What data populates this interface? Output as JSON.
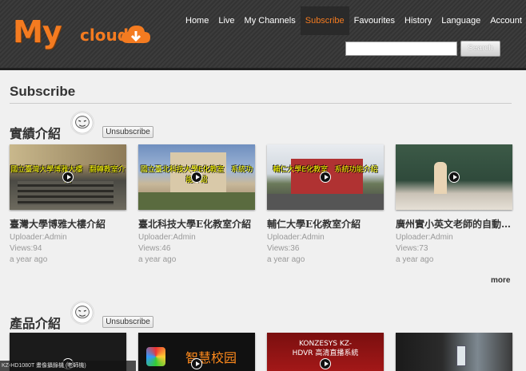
{
  "logo": {
    "my": "My",
    "cloud": "cloud"
  },
  "nav": [
    "Home",
    "Live",
    "My Channels",
    "Subscribe",
    "Favourites",
    "History",
    "Language",
    "Account"
  ],
  "search": {
    "value": "",
    "button": "Search"
  },
  "page_title": "Subscribe",
  "sections": [
    {
      "title": "實績介紹",
      "unsubscribe": "Unsubscribe",
      "videos": [
        {
          "title": "臺灣大學博雅大樓介紹",
          "uploader": "Uploader:Admin",
          "views": "Views:94",
          "date": "a year ago",
          "overlay": "國立臺灣大學博雅大樓   翻轉教室介紹"
        },
        {
          "title": "臺北科技大學E化教室介紹",
          "uploader": "Uploader:Admin",
          "views": "Views:46",
          "date": "a year ago",
          "overlay": "國立臺北科技大學E化教室   系統功能介紹"
        },
        {
          "title": "輔仁大學E化教室介紹",
          "uploader": "Uploader:Admin",
          "views": "Views:36",
          "date": "a year ago",
          "overlay": "輔仁大學E化教室   系統功能介紹"
        },
        {
          "title": "廣州實小英文老師的自動…",
          "uploader": "Uploader:Admin",
          "views": "Views:73",
          "date": "a year ago",
          "overlay": ""
        }
      ],
      "more": "more"
    },
    {
      "title": "產品介紹",
      "unsubscribe": "Unsubscribe",
      "videos": [
        {
          "overlay": "KZ-HD1080T 畫像攝錄機 (老師機)"
        },
        {
          "overlay": "智慧校园"
        },
        {
          "overlay": "KONZESYS KZ-HDVR 高清直播系統"
        },
        {
          "overlay": ""
        }
      ]
    }
  ]
}
